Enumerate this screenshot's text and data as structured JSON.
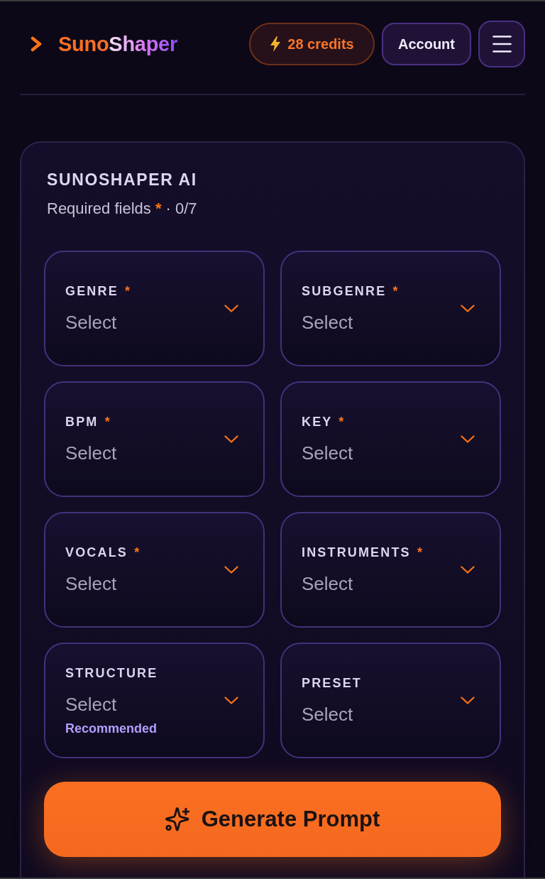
{
  "header": {
    "logo": {
      "part_1": "Suno",
      "part_2": "Shaper"
    },
    "credits_button": {
      "label": "28 credits"
    },
    "account_button": {
      "label": "Account"
    }
  },
  "form": {
    "title": "SUNOSHAPER AI",
    "subtitle": {
      "text": "Required fields",
      "mark": "*",
      "progress": "· 0/7"
    },
    "fields": [
      {
        "label": "GENRE",
        "required_mark": "*",
        "placeholder": "Select"
      },
      {
        "label": "SUBGENRE",
        "required_mark": "*",
        "placeholder": "Select"
      },
      {
        "label": "BPM",
        "required_mark": "*",
        "placeholder": "Select"
      },
      {
        "label": "KEY",
        "required_mark": "*",
        "placeholder": "Select"
      },
      {
        "label": "VOCALS",
        "required_mark": "*",
        "placeholder": "Select"
      },
      {
        "label": "INSTRUMENTS",
        "required_mark": "*",
        "placeholder": "Select"
      },
      {
        "label": "STRUCTURE",
        "placeholder": "Select",
        "hint": "Recommended"
      },
      {
        "label": "PRESET",
        "placeholder": "Select"
      }
    ],
    "generate_button": {
      "label": "Generate Prompt"
    }
  }
}
